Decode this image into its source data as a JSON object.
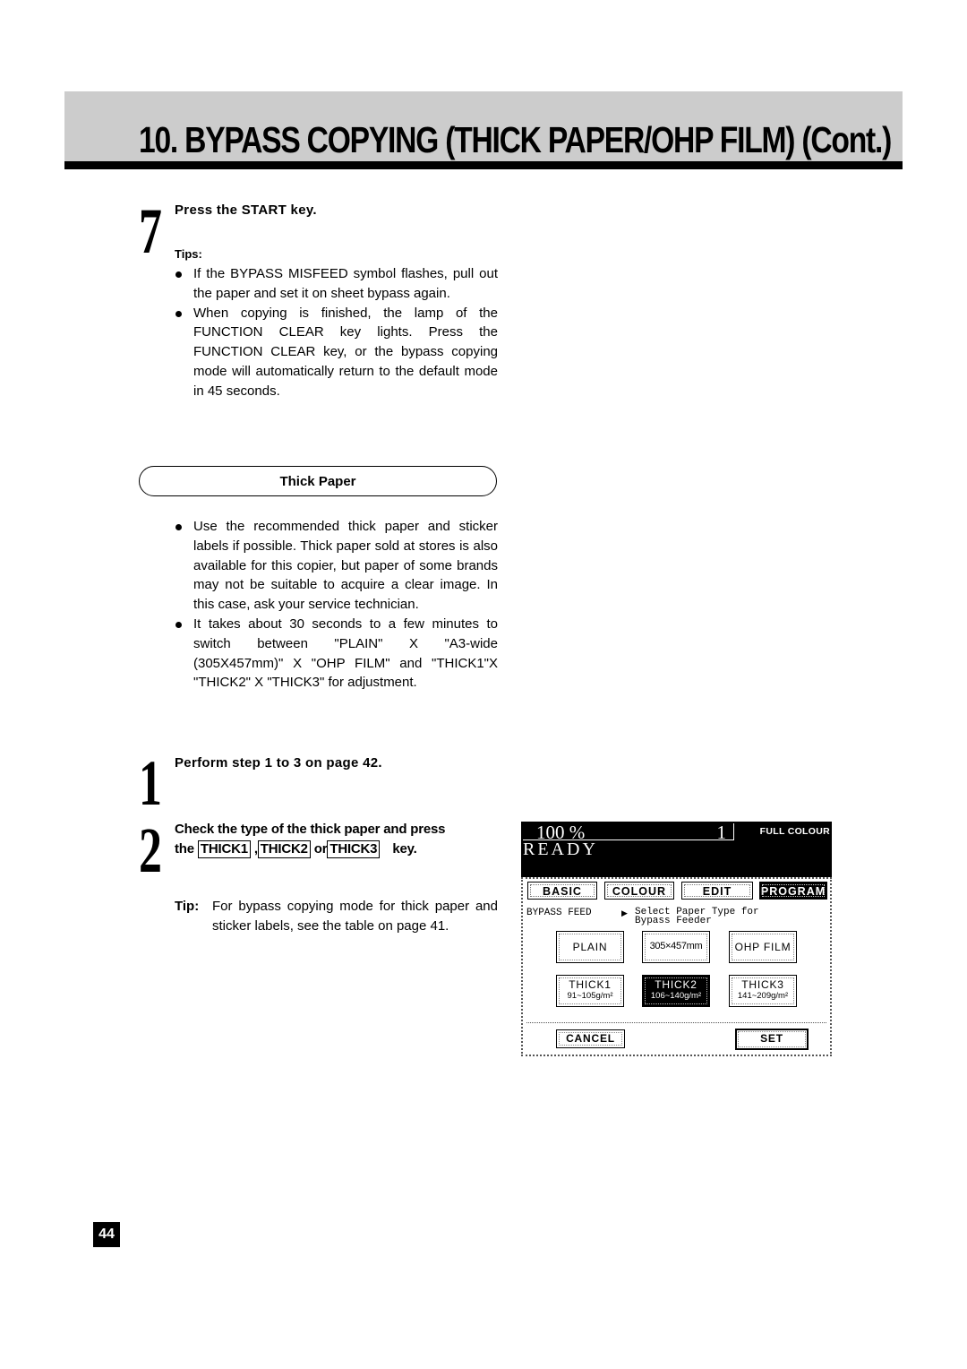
{
  "header": {
    "title": "10. BYPASS COPYING (THICK PAPER/OHP FILM) (Cont.)"
  },
  "step7": {
    "number": "7",
    "title": "Press the START key.",
    "tips_label": "Tips:",
    "tips": [
      "If the BYPASS MISFEED symbol flashes, pull out the paper and set it on sheet bypass again.",
      "When copying is finished, the lamp of the FUNCTION CLEAR key lights.  Press the FUNCTION CLEAR key, or the bypass copying mode will automatically return to the default mode in 45 seconds."
    ]
  },
  "thick_paper": {
    "heading": "Thick Paper",
    "bullets": [
      "Use the recommended thick paper and sticker labels if possible.  Thick paper sold at stores is also available for this copier, but paper of some brands may not be suitable to acquire a clear image.  In this case, ask your service technician.",
      "It takes about 30 seconds to a few minutes to switch between \"PLAIN\" X \"A3-wide (305X457mm)\" X \"OHP FILM\" and \"THICK1\"X \"THICK2\" X \"THICK3\" for adjustment."
    ]
  },
  "step1": {
    "number": "1",
    "title": "Perform step 1 to 3 on page 42."
  },
  "step2": {
    "number": "2",
    "title_line1": "Check the type of the thick paper and press",
    "the": "the",
    "key1": "THICK1",
    "comma": ",",
    "key2": "THICK2",
    "or": "or",
    "key3": "THICK3",
    "key_word": "key.",
    "tip_label": "Tip:",
    "tip_text": "For bypass copying mode for thick paper and sticker labels, see the table on page 41."
  },
  "screen": {
    "zoom": "100  %",
    "copies": "1",
    "colour_mode": "FULL COLOUR",
    "status": "READY",
    "tabs": [
      {
        "label": "BASIC",
        "active": false
      },
      {
        "label": "COLOUR",
        "active": false
      },
      {
        "label": "EDIT",
        "active": false
      },
      {
        "label": "PROGRAM",
        "active": true
      }
    ],
    "mode_label": "BYPASS FEED",
    "message_line1": "Select Paper Type for",
    "message_line2": "Bypass Feeder",
    "paper_buttons": [
      {
        "label": "PLAIN",
        "sub": "",
        "selected": false
      },
      {
        "label": "305×457mm",
        "sub": "",
        "selected": false
      },
      {
        "label": "OHP FILM",
        "sub": "",
        "selected": false
      },
      {
        "label": "THICK1",
        "sub": "91~105g/m²",
        "selected": false
      },
      {
        "label": "THICK2",
        "sub": "106~140g/m²",
        "selected": true
      },
      {
        "label": "THICK3",
        "sub": "141~209g/m²",
        "selected": false
      }
    ],
    "cancel_label": "CANCEL",
    "set_label": "SET"
  },
  "page_number": "44"
}
